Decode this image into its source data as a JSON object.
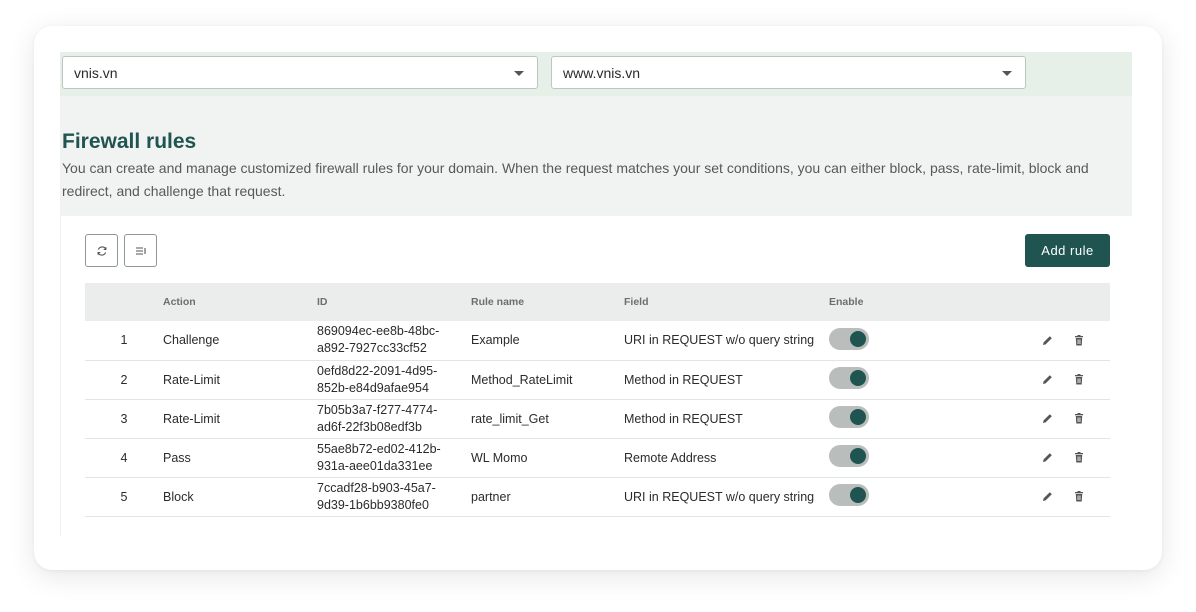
{
  "selectors": {
    "account": "vnis.vn",
    "domain": "www.vnis.vn"
  },
  "header": {
    "title": "Firewall rules",
    "description": "You can create and manage customized firewall rules for your domain. When the request matches your set conditions, you can either block, pass, rate-limit, block and redirect, and challenge that request."
  },
  "toolbar": {
    "refresh_icon": "refresh-icon",
    "columns_icon": "column-settings-icon",
    "add_rule_label": "Add rule"
  },
  "table": {
    "columns": [
      "",
      "Action",
      "ID",
      "Rule name",
      "Field",
      "Enable"
    ],
    "rows": [
      {
        "index": "1",
        "action": "Challenge",
        "id_line1": "869094ec-ee8b-48bc-",
        "id_line2": "a892-7927cc33cf52",
        "name": "Example",
        "field": "URI in REQUEST w/o query string",
        "enabled": true
      },
      {
        "index": "2",
        "action": "Rate-Limit",
        "id_line1": "0efd8d22-2091-4d95-",
        "id_line2": "852b-e84d9afae954",
        "name": "Method_RateLimit",
        "field": "Method in REQUEST",
        "enabled": true
      },
      {
        "index": "3",
        "action": "Rate-Limit",
        "id_line1": "7b05b3a7-f277-4774-",
        "id_line2": "ad6f-22f3b08edf3b",
        "name": "rate_limit_Get",
        "field": "Method in REQUEST",
        "enabled": true
      },
      {
        "index": "4",
        "action": "Pass",
        "id_line1": "55ae8b72-ed02-412b-",
        "id_line2": "931a-aee01da331ee",
        "name": "WL Momo",
        "field": "Remote Address",
        "enabled": true
      },
      {
        "index": "5",
        "action": "Block",
        "id_line1": "7ccadf28-b903-45a7-",
        "id_line2": "9d39-1b6bb9380fe0",
        "name": "partner",
        "field": "URI in REQUEST w/o query string",
        "enabled": true
      }
    ]
  },
  "colors": {
    "primary": "#1f5450",
    "topbar_bg": "#e7efe9",
    "panel_bg": "#f1f3f2",
    "toggle_track": "#b9bdbb"
  }
}
